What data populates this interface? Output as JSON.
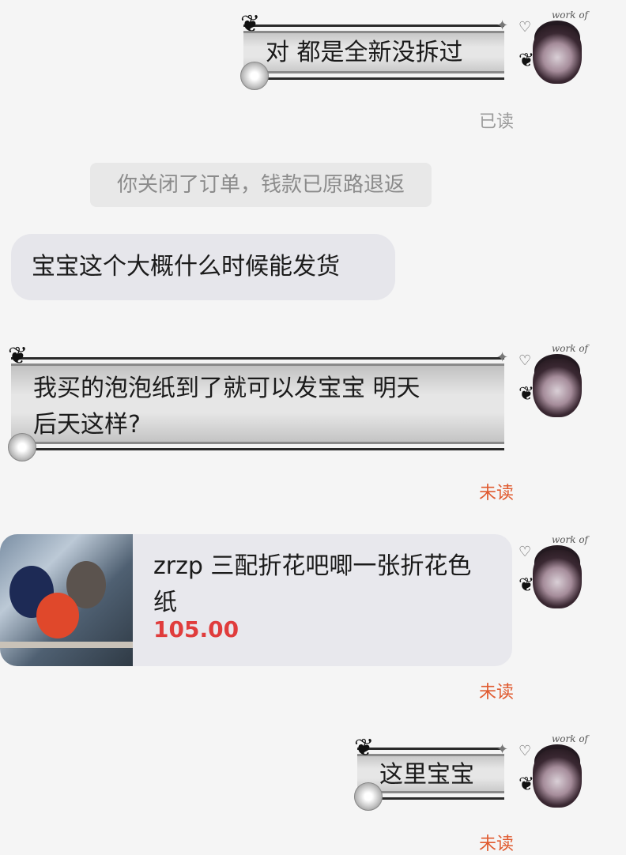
{
  "messages": [
    {
      "id": "m1",
      "text": "对 都是全新没拆过",
      "status": "已读"
    },
    {
      "id": "sys",
      "text": "你关闭了订单，钱款已原路退返"
    },
    {
      "id": "m2",
      "text": "宝宝这个大概什么时候能发货"
    },
    {
      "id": "m3",
      "line1": "我买的泡泡纸到了就可以发宝宝 明天",
      "line2": "后天这样?",
      "status": "未读"
    },
    {
      "id": "m5",
      "text": "这里宝宝",
      "status": "未读"
    }
  ],
  "product_card": {
    "title": "zrzp 三配折花吧唧一张折花色纸",
    "price": "105.00",
    "status": "未读"
  },
  "avatar_signature": "work of art",
  "colors": {
    "unread": "#e05a2f",
    "read": "#9a9a9a",
    "price": "#e03c3c"
  }
}
